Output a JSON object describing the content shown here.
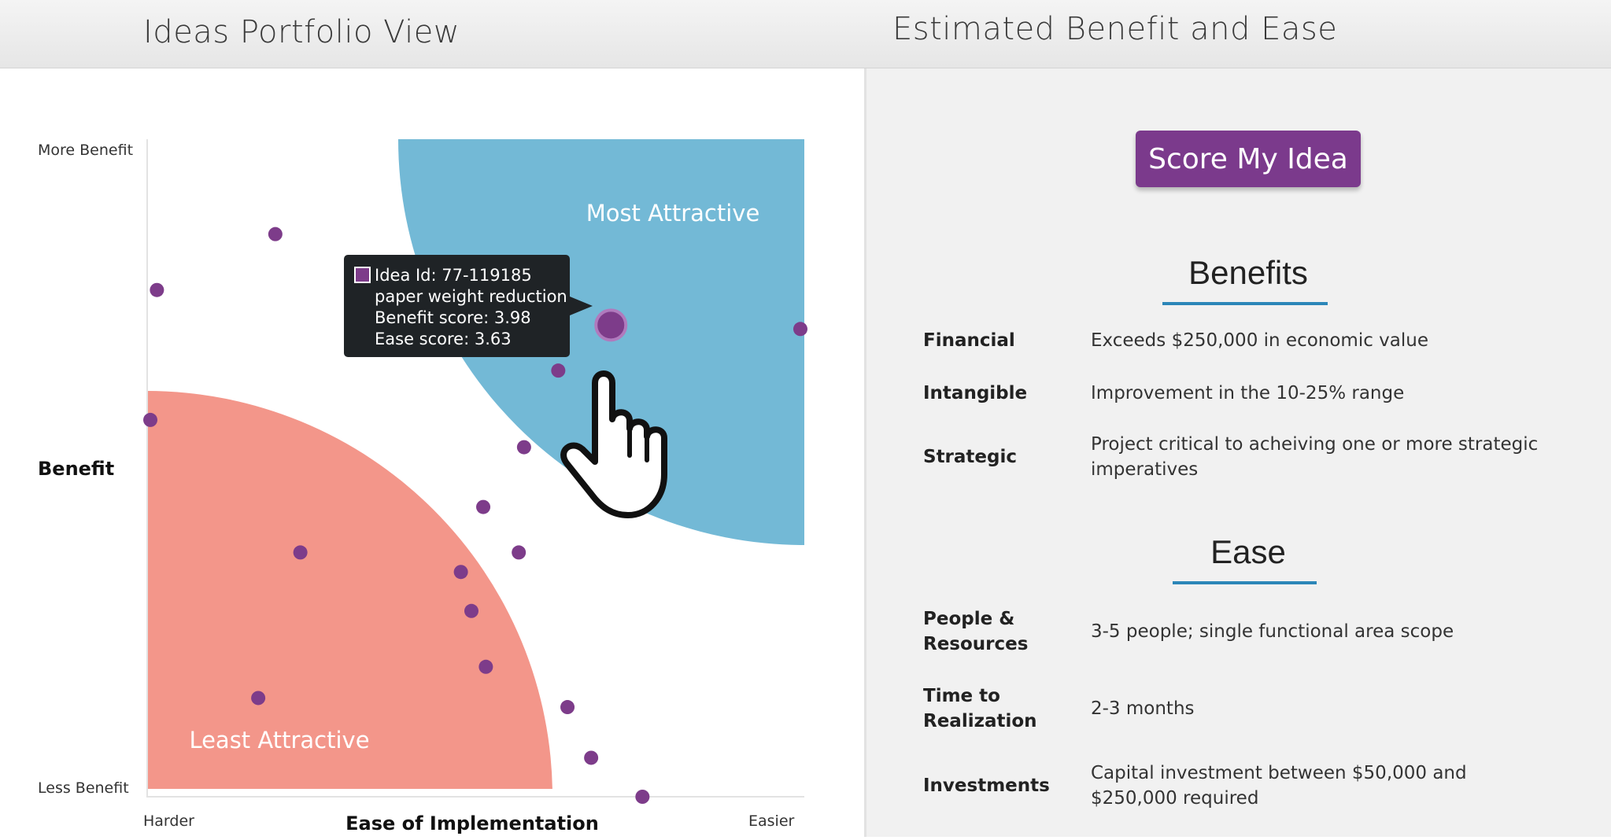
{
  "header": {
    "left_title": "Ideas Portfolio View",
    "right_title": "Estimated Benefit and Ease"
  },
  "chart": {
    "y_top_label": "More Benefit",
    "y_bottom_label": "Less Benefit",
    "y_axis_title": "Benefit",
    "x_left_label": "Harder",
    "x_right_label": "Easier",
    "x_axis_title": "Ease of Implementation",
    "region_most": "Most Attractive",
    "region_least": "Least Attractive",
    "colors": {
      "most": "#73b9d6",
      "least": "#f3968a",
      "point": "#7d3c8a",
      "tooltip_bg": "#1f2326"
    },
    "tooltip": {
      "line1": "Idea Id: 77-119185",
      "line2": "paper weight reduction",
      "line3": "Benefit score: 3.98",
      "line4": "Ease score: 3.63"
    }
  },
  "chart_data": {
    "type": "scatter",
    "xlabel": "Ease of Implementation",
    "ylabel": "Benefit",
    "xlim": [
      0,
      5
    ],
    "ylim": [
      0,
      5
    ],
    "points": [
      {
        "x": 0.98,
        "y": 4.33
      },
      {
        "x": 0.08,
        "y": 3.9
      },
      {
        "x": 3.53,
        "y": 3.63,
        "highlighted": true
      },
      {
        "x": 4.97,
        "y": 3.6
      },
      {
        "x": 3.13,
        "y": 3.28
      },
      {
        "x": 0.03,
        "y": 2.9
      },
      {
        "x": 2.87,
        "y": 2.69
      },
      {
        "x": 2.56,
        "y": 2.23
      },
      {
        "x": 1.17,
        "y": 1.88
      },
      {
        "x": 2.39,
        "y": 1.73
      },
      {
        "x": 2.83,
        "y": 1.88
      },
      {
        "x": 2.47,
        "y": 1.43
      },
      {
        "x": 2.58,
        "y": 1.0
      },
      {
        "x": 0.85,
        "y": 0.76
      },
      {
        "x": 3.2,
        "y": 0.69
      },
      {
        "x": 3.38,
        "y": 0.3
      },
      {
        "x": 3.77,
        "y": 0.0
      }
    ]
  },
  "score_button": {
    "label": "Score My Idea"
  },
  "benefits": {
    "title": "Benefits",
    "rows": [
      {
        "label": "Financial",
        "value": "Exceeds $250,000 in economic value"
      },
      {
        "label": "Intangible",
        "value": "Improvement in the 10-25% range"
      },
      {
        "label": "Strategic",
        "value": "Project critical to acheiving one or more strategic imperatives"
      }
    ]
  },
  "ease": {
    "title": "Ease",
    "rows": [
      {
        "label": "People & Resources",
        "value": "3-5 people; single functional area scope"
      },
      {
        "label": "Time to Realization",
        "value": "2-3 months"
      },
      {
        "label": "Investments",
        "value": "Capital investment between $50,000 and $250,000 required"
      }
    ]
  }
}
